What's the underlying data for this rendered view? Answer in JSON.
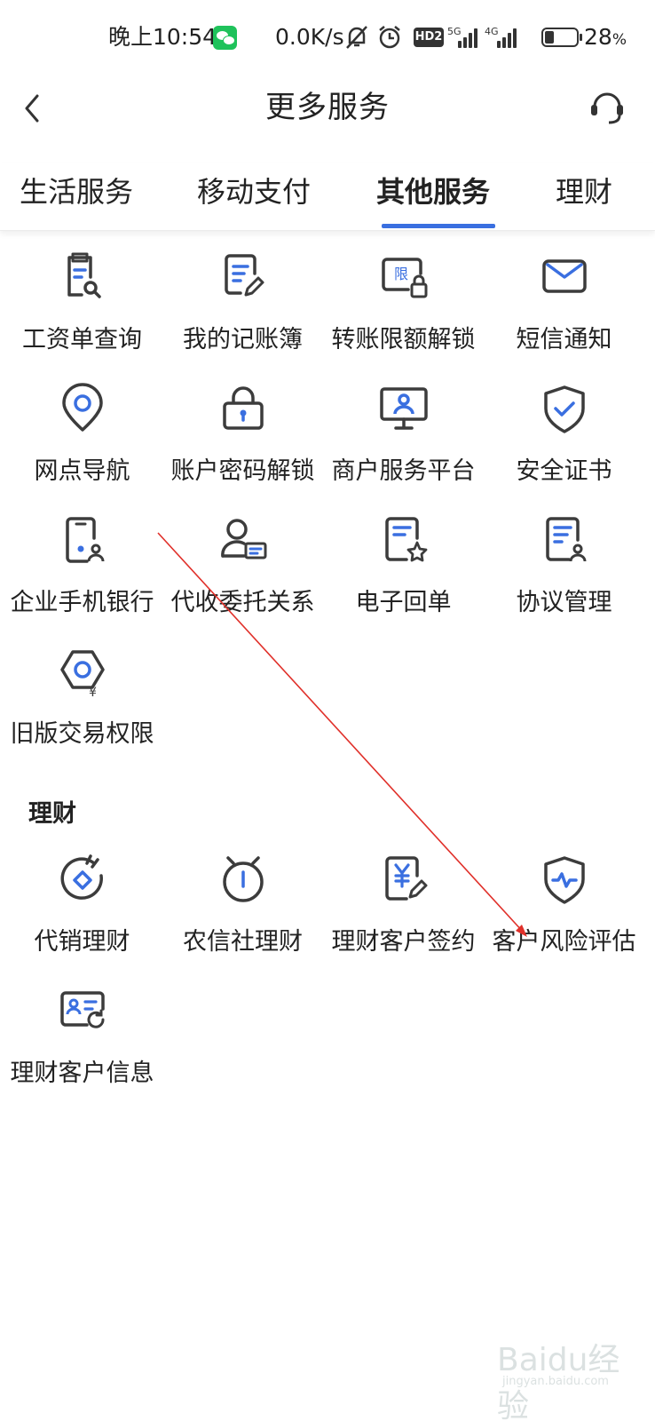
{
  "status_bar": {
    "time": "晚上10:54",
    "net_speed": "0.0K/s",
    "hd_label": "HD2",
    "net1": "5G",
    "net2": "4G",
    "battery_value": "28",
    "battery_unit": "%",
    "battery_level": 0.28
  },
  "header": {
    "title": "更多服务"
  },
  "tabs": [
    {
      "label": "生活服务",
      "active": false
    },
    {
      "label": "移动支付",
      "active": false
    },
    {
      "label": "其他服务",
      "active": true
    },
    {
      "label": "理财",
      "active": false
    }
  ],
  "other_services": [
    {
      "label": "工资单查询",
      "icon": "payslip-search-icon"
    },
    {
      "label": "我的记账簿",
      "icon": "ledger-edit-icon"
    },
    {
      "label": "转账限额解锁",
      "icon": "transfer-limit-unlock-icon"
    },
    {
      "label": "短信通知",
      "icon": "envelope-icon"
    },
    {
      "label": "网点导航",
      "icon": "location-pin-icon"
    },
    {
      "label": "账户密码解锁",
      "icon": "padlock-icon"
    },
    {
      "label": "商户服务平台",
      "icon": "merchant-monitor-icon"
    },
    {
      "label": "安全证书",
      "icon": "shield-check-icon"
    },
    {
      "label": "企业手机银行",
      "icon": "mobile-user-icon"
    },
    {
      "label": "代收委托关系",
      "icon": "user-card-icon"
    },
    {
      "label": "电子回单",
      "icon": "receipt-star-icon"
    },
    {
      "label": "协议管理",
      "icon": "agreement-user-icon"
    },
    {
      "label": "旧版交易权限",
      "icon": "hexagon-yuan-icon"
    }
  ],
  "finance_section": {
    "title": "理财",
    "items": [
      {
        "label": "代销理财",
        "icon": "agency-finance-icon"
      },
      {
        "label": "农信社理财",
        "icon": "alarm-clock-icon"
      },
      {
        "label": "理财客户签约",
        "icon": "yuan-sign-icon"
      },
      {
        "label": "客户风险评估",
        "icon": "shield-pulse-icon"
      },
      {
        "label": "理财客户信息",
        "icon": "id-card-refresh-icon"
      }
    ]
  },
  "colors": {
    "accent": "#3a6fe0",
    "icon_stroke": "#3c3c3c",
    "annotation": "#e0302a"
  },
  "watermark": {
    "brand": "Baidu经验",
    "url": "jingyan.baidu.com"
  }
}
